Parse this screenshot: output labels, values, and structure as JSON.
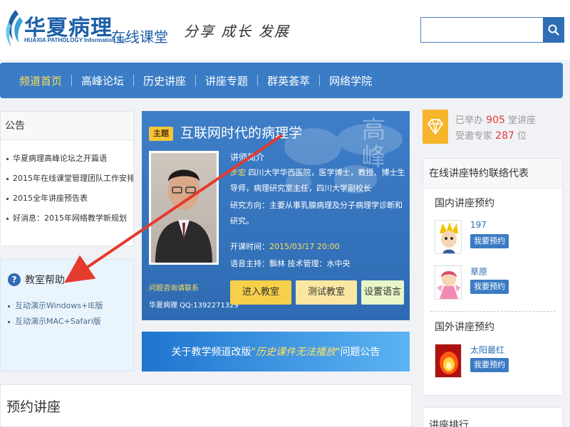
{
  "header": {
    "logo_cn": "华夏病理",
    "logo_en": "HUAXIA PATHOLOGY Information Net",
    "logo_sub": "在线课堂",
    "slogan": "分享 成长 发展",
    "search": {
      "placeholder": "",
      "value": ""
    }
  },
  "nav": {
    "items": [
      "频道首页",
      "高峰论坛",
      "历史讲座",
      "讲座专题",
      "群英荟萃",
      "网络学院"
    ],
    "active_index": 0
  },
  "notice": {
    "title": "公告",
    "items": [
      "华夏病理高峰论坛之开篇语",
      "2015年在线课堂管理团队工作安排",
      "2015全年讲座预告表",
      "好消息：2015年网络教学新规划"
    ]
  },
  "help": {
    "title": "教室帮助",
    "items": [
      "互动演示Windows+IE版",
      "互动演示MAC+Safari版"
    ]
  },
  "lecture": {
    "tag": "主题",
    "title": "互联网时代的病理学",
    "watermark": "高峰",
    "intro_label": "讲师简介",
    "lecturer": "步宏",
    "intro_text": "四川大学华西医院，医学博士，教授、博士生导师，病理研究室主任，四川大学副校长",
    "research": "研究方向：主要从事乳腺病理及分子病理学诊断和研究。",
    "time_label": "开课时间：",
    "time_value": "2015/03/17 20:00",
    "staff": "语音主持：飘林    技术管理：水中央",
    "consult_title": "问题咨询请联系",
    "consult_qq": "华夏病理 QQ:1392271329",
    "buttons": {
      "enter": "进入教室",
      "test": "测试教室",
      "lang": "设置语言"
    }
  },
  "banner": {
    "prefix": "关于教学频道改版",
    "highlight": "\"历史课件无法播放\"",
    "suffix": "问题公告"
  },
  "booked": {
    "title": "预约讲座"
  },
  "stats": {
    "held_prefix": "已举办",
    "held_count": "905",
    "held_suffix": "堂讲座",
    "experts_prefix": "受邀专家",
    "experts_count": "287",
    "experts_suffix": "位"
  },
  "reps": {
    "title": "在线讲座特约联络代表",
    "domestic_title": "国内讲座预约",
    "foreign_title": "国外讲座预约",
    "domestic": [
      {
        "name": "197",
        "button": "我要预约"
      },
      {
        "name": "草原",
        "button": "我要预约"
      }
    ],
    "foreign": [
      {
        "name": "太阳最红",
        "button": "我要预约"
      }
    ]
  },
  "rank": {
    "title": "讲座排行"
  },
  "colors": {
    "brand_blue": "#1c5fa8",
    "nav_blue": "#3a7cc6",
    "active_yellow": "#ffde5a",
    "accent_red": "#e4393c",
    "arrow_red": "#e53a2e"
  }
}
